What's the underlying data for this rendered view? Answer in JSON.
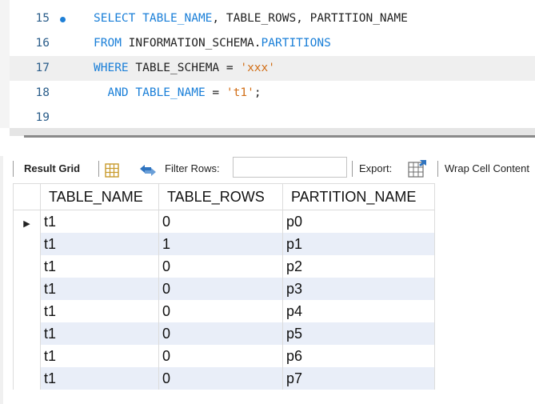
{
  "editor": {
    "lines": [
      {
        "number": "15",
        "breakpoint": true,
        "tokens": [
          {
            "t": "SELECT ",
            "c": "kw"
          },
          {
            "t": "TABLE_NAME",
            "c": "kw"
          },
          {
            "t": ", TABLE_ROWS, PARTITION_NAME",
            "c": ""
          }
        ]
      },
      {
        "number": "16",
        "breakpoint": false,
        "tokens": [
          {
            "t": "FROM ",
            "c": "kw"
          },
          {
            "t": "INFORMATION_SCHEMA.",
            "c": ""
          },
          {
            "t": "PARTITIONS",
            "c": "kw"
          }
        ]
      },
      {
        "number": "17",
        "breakpoint": false,
        "current": true,
        "tokens": [
          {
            "t": "WHERE ",
            "c": "kw"
          },
          {
            "t": "TABLE_SCHEMA = ",
            "c": ""
          },
          {
            "t": "'xxx'",
            "c": "str"
          }
        ]
      },
      {
        "number": "18",
        "breakpoint": false,
        "tokens": [
          {
            "t": "  AND ",
            "c": "kw"
          },
          {
            "t": "TABLE_NAME",
            "c": "kw"
          },
          {
            "t": " = ",
            "c": ""
          },
          {
            "t": "'t1'",
            "c": "str"
          },
          {
            "t": ";",
            "c": ""
          }
        ]
      },
      {
        "number": "19",
        "breakpoint": false,
        "tokens": []
      }
    ]
  },
  "toolbar": {
    "result_grid_label": "Result Grid",
    "filter_rows_label": "Filter Rows:",
    "filter_value": "",
    "export_label": "Export:",
    "wrap_label": "Wrap Cell Content"
  },
  "grid": {
    "columns": [
      "TABLE_NAME",
      "TABLE_ROWS",
      "PARTITION_NAME"
    ],
    "rows": [
      [
        "t1",
        "0",
        "p0"
      ],
      [
        "t1",
        "1",
        "p1"
      ],
      [
        "t1",
        "0",
        "p2"
      ],
      [
        "t1",
        "0",
        "p3"
      ],
      [
        "t1",
        "0",
        "p4"
      ],
      [
        "t1",
        "0",
        "p5"
      ],
      [
        "t1",
        "0",
        "p6"
      ],
      [
        "t1",
        "0",
        "p7"
      ]
    ],
    "current_row_marker": "▶"
  },
  "colors": {
    "keyword": "#1a7fd8",
    "string": "#d26f18",
    "line_number": "#2a5d8a",
    "alt_row": "#e9eef8"
  }
}
